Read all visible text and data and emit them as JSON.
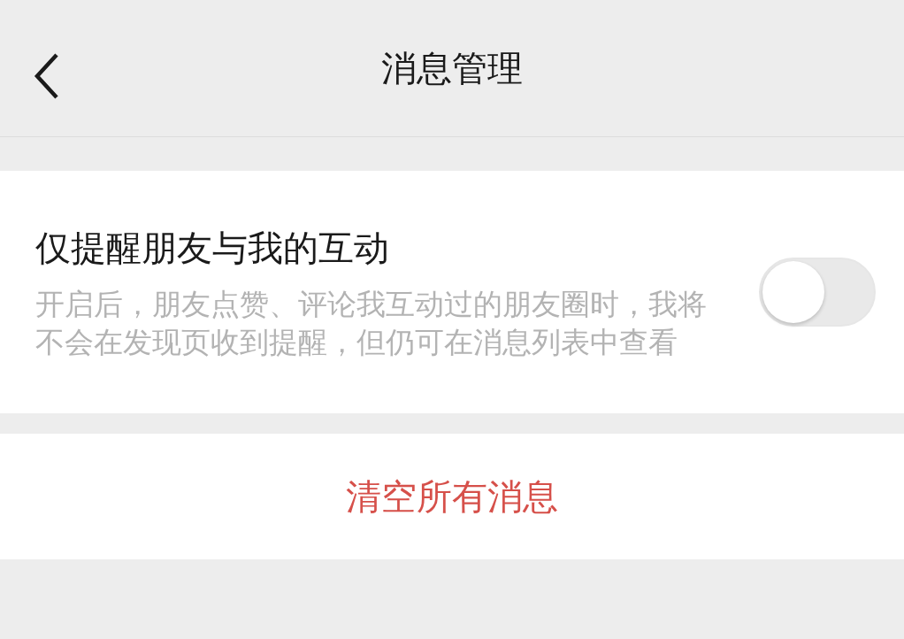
{
  "header": {
    "title": "消息管理"
  },
  "setting": {
    "title": "仅提醒朋友与我的互动",
    "description": "开启后，朋友点赞、评论我互动过的朋友圈时，我将不会在发现页收到提醒，但仍可在消息列表中查看",
    "on": false
  },
  "action": {
    "label": "清空所有消息"
  }
}
